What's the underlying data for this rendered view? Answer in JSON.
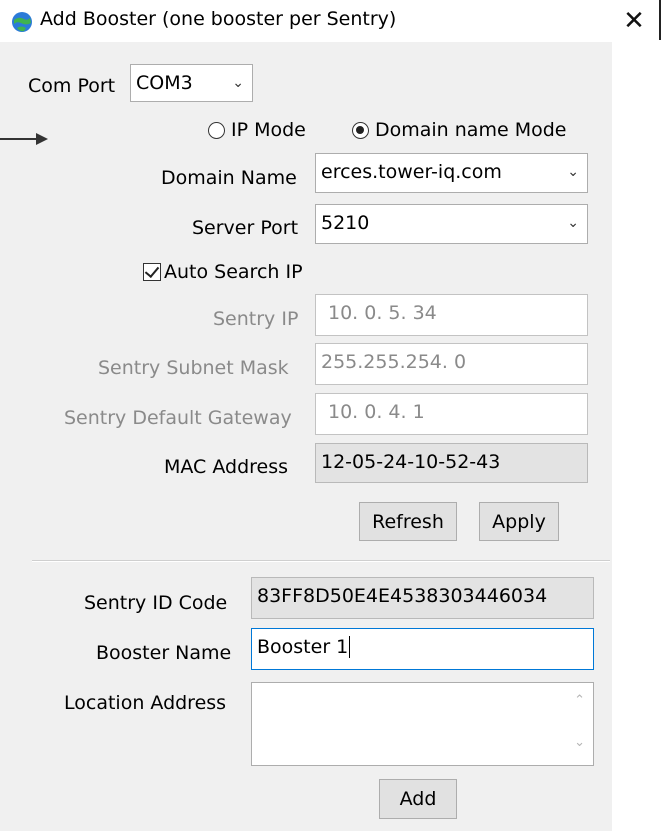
{
  "window": {
    "title": "Add Booster (one booster per Sentry)",
    "close_glyph": "✕",
    "icon": "app-globe-icon"
  },
  "com_port": {
    "label": "Com Port",
    "value": "COM3"
  },
  "mode": {
    "ip_mode_label": "IP Mode",
    "domain_mode_label": "Domain name Mode",
    "selected": "Domain name Mode"
  },
  "domain_name": {
    "label": "Domain Name",
    "value": "erces.tower-iq.com"
  },
  "server_port": {
    "label": "Server Port",
    "value": "5210"
  },
  "auto_search": {
    "label": "Auto Search IP",
    "checked": true
  },
  "sentry_ip": {
    "label": "Sentry IP",
    "value": "10.  0.  5. 34"
  },
  "subnet_mask": {
    "label": "Sentry Subnet Mask",
    "value": "255.255.254.  0"
  },
  "gateway": {
    "label": "Sentry Default Gateway",
    "value": "10.  0.  4.  1"
  },
  "mac": {
    "label": "MAC Address",
    "value": "12-05-24-10-52-43"
  },
  "buttons": {
    "refresh": "Refresh",
    "apply": "Apply",
    "add": "Add"
  },
  "sentry_id": {
    "label": "Sentry ID Code",
    "value": "83FF8D50E4E4538303446034"
  },
  "booster_name": {
    "label": "Booster Name",
    "value": "Booster 1"
  },
  "location": {
    "label": "Location Address",
    "value": ""
  },
  "colors": {
    "dialog_bg": "#f0f0f0",
    "focus_border": "#0078d7",
    "disabled_text": "#8a8a8a"
  }
}
